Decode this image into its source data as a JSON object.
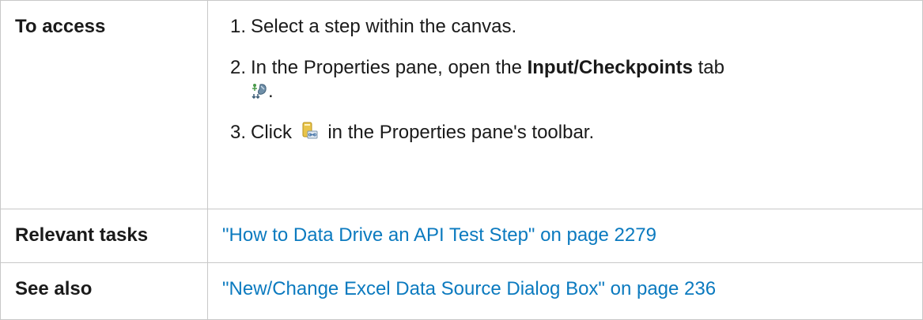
{
  "rows": {
    "access": {
      "label": "To access",
      "steps": [
        {
          "number": "1.",
          "text": "Select a step within the canvas."
        },
        {
          "number": "2.",
          "text_before": "In the Properties pane, open the ",
          "bold": "Input/Checkpoints",
          "text_after": " tab",
          "icon": "input-checkpoints-icon",
          "trailing": "."
        },
        {
          "number": "3.",
          "text_before": "Click ",
          "icon": "data-source-link-icon",
          "text_after": " in the Properties pane's toolbar."
        }
      ]
    },
    "relevant_tasks": {
      "label": "Relevant tasks",
      "link": "\"How to Data Drive an API Test Step\" on page 2279"
    },
    "see_also": {
      "label": "See also",
      "link": "\"New/Change Excel Data Source Dialog Box\" on page 236"
    }
  },
  "colors": {
    "link": "#0b7abf",
    "border": "#c8c8c8",
    "text": "#1a1a1a"
  }
}
